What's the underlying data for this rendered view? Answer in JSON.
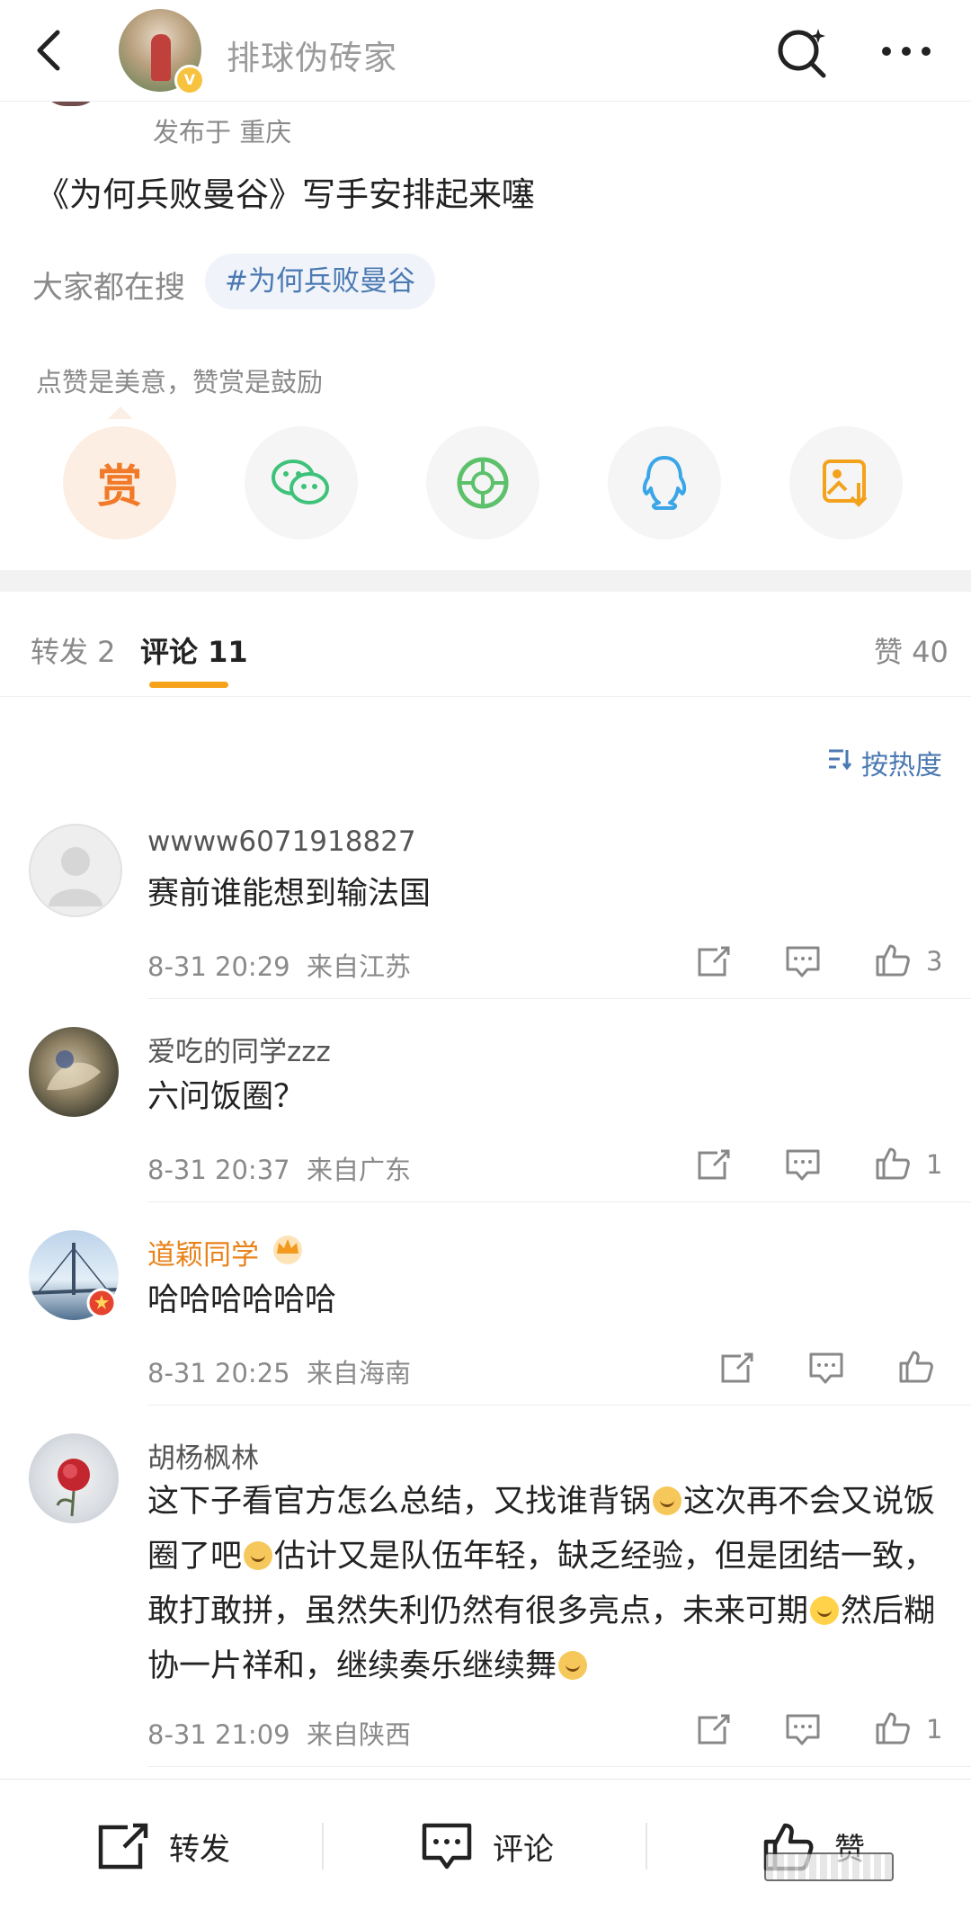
{
  "header": {
    "title": "排球伪砖家",
    "verified_badge": "V",
    "icons": [
      "back-icon",
      "search-icon",
      "more-icon"
    ]
  },
  "post": {
    "location": "发布于 重庆",
    "text": "《为何兵败曼谷》写手安排起来噻",
    "search_label": "大家都在搜",
    "tag": "#为何兵败曼谷",
    "reward_hint": "点赞是美意，赞赏是鼓励",
    "reward_button": "赏",
    "share_icons": [
      "wechat-icon",
      "moments-icon",
      "qq-icon",
      "save-image-icon"
    ]
  },
  "tabs": {
    "repost": "转发 2",
    "comments": "评论 11",
    "likes": "赞 40",
    "sort": "按热度"
  },
  "comments": [
    {
      "user": "wwww6071918827",
      "text": "赛前谁能想到输法国",
      "time": "8-31 20:29",
      "location": "来自江苏",
      "likes": "3"
    },
    {
      "user": "爱吃的同学zzz",
      "text": "六问饭圈？",
      "time": "8-31 20:37",
      "location": "来自广东",
      "likes": "1"
    },
    {
      "user": "道颖同学",
      "text": "哈哈哈哈哈哈",
      "time": "8-31 20:25",
      "location": "来自海南",
      "likes": ""
    },
    {
      "user": "胡杨枫林",
      "text_parts": [
        "这下子看官方怎么总结，又找谁背锅",
        "这次再不会又说饭圈了吧",
        "估计又是队伍年轻，缺乏经验，但是团结一致，敢打敢拼，虽然失利仍然有很多亮点，未来可期",
        "然后糊协一片祥和，继续奏乐继续舞"
      ],
      "time": "8-31 21:09",
      "location": "来自陕西",
      "likes": "1"
    }
  ],
  "bottom_bar": {
    "repost": "转发",
    "comment": "评论",
    "like": "赞"
  },
  "colors": {
    "accent": "#f7a21b",
    "link": "#4b79b2",
    "vip_name": "#e8831b"
  }
}
